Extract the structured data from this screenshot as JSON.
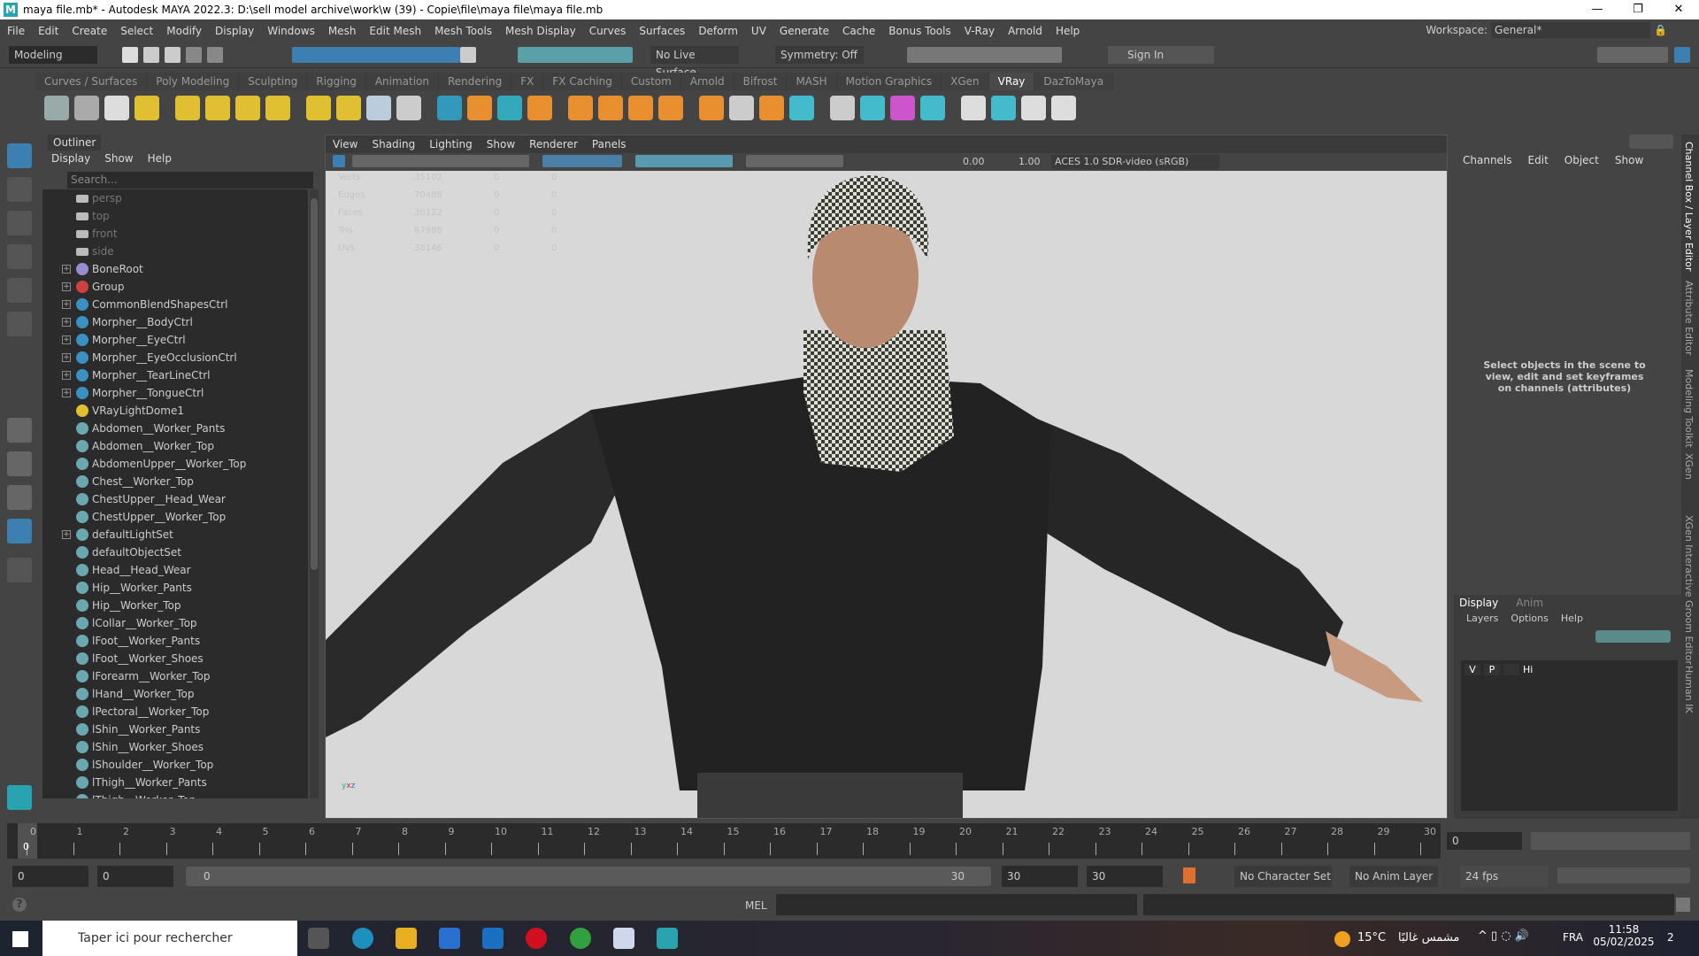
{
  "window": {
    "title": "maya file.mb* - Autodesk MAYA 2022.3: D:\\sell model archive\\work\\w (39) - Copie\\file\\maya file\\maya file.mb",
    "logo": "M",
    "controls": [
      "—",
      "❐",
      "✕"
    ]
  },
  "menubar": {
    "items": [
      "File",
      "Edit",
      "Create",
      "Select",
      "Modify",
      "Display",
      "Windows",
      "Mesh",
      "Edit Mesh",
      "Mesh Tools",
      "Mesh Display",
      "Curves",
      "Surfaces",
      "Deform",
      "UV",
      "Generate",
      "Cache",
      "Bonus Tools",
      "V-Ray",
      "Arnold",
      "Help"
    ],
    "workspace_label": "Workspace:",
    "workspace_value": "General*"
  },
  "statusline": {
    "mode": "Modeling",
    "live_surface": "No Live Surface",
    "symmetry": "Symmetry: Off",
    "sign_in": "Sign In"
  },
  "shelf": {
    "tabs": [
      "Curves / Surfaces",
      "Poly Modeling",
      "Sculpting",
      "Rigging",
      "Animation",
      "Rendering",
      "FX",
      "FX Caching",
      "Custom",
      "Arnold",
      "Bifrost",
      "MASH",
      "Motion Graphics",
      "XGen",
      "VRay",
      "DazToMaya"
    ],
    "active_tab": "VRay",
    "icon_colors": [
      "#9aa",
      "#aaa",
      "#ddd",
      "#e0c030",
      "#e0c030",
      "#e0c030",
      "#e0c030",
      "#e0c030",
      "#e0c030",
      "#e0c030",
      "#bcd",
      "#ccc",
      "#39b",
      "#e89030",
      "#3ab",
      "#e89030",
      "#e89030",
      "#e89030",
      "#e89030",
      "#e89030",
      "#e89030",
      "#ccc",
      "#e89030",
      "#4bc",
      "#ccc",
      "#4bc",
      "#c5c",
      "#4bc",
      "#ddd",
      "#4bc",
      "#ddd",
      "#ddd"
    ]
  },
  "outliner": {
    "title": "Outliner",
    "menu": [
      "Display",
      "Show",
      "Help"
    ],
    "search_placeholder": "Search...",
    "items": [
      {
        "label": "persp",
        "type": "camera",
        "dim": true
      },
      {
        "label": "top",
        "type": "camera",
        "dim": true
      },
      {
        "label": "front",
        "type": "camera",
        "dim": true
      },
      {
        "label": "side",
        "type": "camera",
        "dim": true
      },
      {
        "label": "BoneRoot",
        "type": "joint",
        "expand": true
      },
      {
        "label": "Group",
        "type": "group",
        "expand": true
      },
      {
        "label": "CommonBlendShapesCtrl",
        "type": "curve",
        "expand": true
      },
      {
        "label": "Morpher__BodyCtrl",
        "type": "curve",
        "expand": true
      },
      {
        "label": "Morpher__EyeCtrl",
        "type": "curve",
        "expand": true
      },
      {
        "label": "Morpher__EyeOcclusionCtrl",
        "type": "curve",
        "expand": true
      },
      {
        "label": "Morpher__TearLineCtrl",
        "type": "curve",
        "expand": true
      },
      {
        "label": "Morpher__TongueCtrl",
        "type": "curve",
        "expand": true
      },
      {
        "label": "VRayLightDome1",
        "type": "light"
      },
      {
        "label": "Abdomen__Worker_Pants",
        "type": "set"
      },
      {
        "label": "Abdomen__Worker_Top",
        "type": "set"
      },
      {
        "label": "AbdomenUpper__Worker_Top",
        "type": "set"
      },
      {
        "label": "Chest__Worker_Top",
        "type": "set"
      },
      {
        "label": "ChestUpper__Head_Wear",
        "type": "set"
      },
      {
        "label": "ChestUpper__Worker_Top",
        "type": "set"
      },
      {
        "label": "defaultLightSet",
        "type": "set",
        "expand": true
      },
      {
        "label": "defaultObjectSet",
        "type": "set"
      },
      {
        "label": "Head__Head_Wear",
        "type": "set"
      },
      {
        "label": "Hip__Worker_Pants",
        "type": "set"
      },
      {
        "label": "Hip__Worker_Top",
        "type": "set"
      },
      {
        "label": "lCollar__Worker_Top",
        "type": "set"
      },
      {
        "label": "lFoot__Worker_Pants",
        "type": "set"
      },
      {
        "label": "lFoot__Worker_Shoes",
        "type": "set"
      },
      {
        "label": "lForearm__Worker_Top",
        "type": "set"
      },
      {
        "label": "lHand__Worker_Top",
        "type": "set"
      },
      {
        "label": "lPectoral__Worker_Top",
        "type": "set"
      },
      {
        "label": "lShin__Worker_Pants",
        "type": "set"
      },
      {
        "label": "lShin__Worker_Shoes",
        "type": "set"
      },
      {
        "label": "lShoulder__Worker_Top",
        "type": "set"
      },
      {
        "label": "lThigh__Worker_Pants",
        "type": "set"
      },
      {
        "label": "lThigh__Worker_Top",
        "type": "set"
      }
    ]
  },
  "viewport": {
    "menu": [
      "View",
      "Shading",
      "Lighting",
      "Show",
      "Renderer",
      "Panels"
    ],
    "exposure": "0.00",
    "gamma": "1.00",
    "color_space": "ACES 1.0 SDR-video (sRGB)",
    "hud": [
      [
        "Verts",
        "35102",
        "0",
        "0"
      ],
      [
        "Edges",
        "70488",
        "0",
        "0"
      ],
      [
        "Faces",
        "30122",
        "0",
        "0"
      ],
      [
        "Tris",
        "67988",
        "0",
        "0"
      ],
      [
        "UVs",
        "38146",
        "0",
        "0"
      ]
    ],
    "axis": {
      "y": "y",
      "x": "x",
      "z": "z"
    }
  },
  "channelbox": {
    "menu": [
      "Channels",
      "Edit",
      "Object",
      "Show"
    ],
    "hint": "Select objects in the scene to view, edit and set keyframes on channels (attributes)"
  },
  "layereditor": {
    "tabs": [
      "Display",
      "Anim"
    ],
    "menu": [
      "Layers",
      "Options",
      "Help"
    ],
    "layer": {
      "v": "V",
      "p": "P",
      "name": "Hi"
    }
  },
  "sidetabs": [
    "Channel Box / Layer Editor",
    "Attribute Editor",
    "Modeling Toolkit",
    "XGen",
    "XGen Interactive Groom Editor",
    "Human IK"
  ],
  "timeline": {
    "ticks": [
      "0",
      "1",
      "2",
      "3",
      "4",
      "5",
      "6",
      "7",
      "8",
      "9",
      "10",
      "11",
      "12",
      "13",
      "14",
      "15",
      "16",
      "17",
      "18",
      "19",
      "20",
      "21",
      "22",
      "23",
      "24",
      "25",
      "26",
      "27",
      "28",
      "29",
      "30"
    ],
    "current": "0",
    "current_field": "0"
  },
  "range": {
    "start": "0",
    "anim_start": "0",
    "slider_start": "0",
    "slider_end": "30",
    "end": "30",
    "anim_end": "30",
    "character_set": "No Character Set",
    "anim_layer": "No Anim Layer",
    "fps": "24 fps"
  },
  "cmdline": {
    "lang": "MEL",
    "help": "?"
  },
  "taskbar": {
    "search": "Taper ici pour rechercher",
    "weather": "15°C",
    "weather_text": "مشمس غالبًا",
    "lang": "FRA",
    "time": "11:58",
    "date": "05/02/2025",
    "notifications": "2"
  }
}
